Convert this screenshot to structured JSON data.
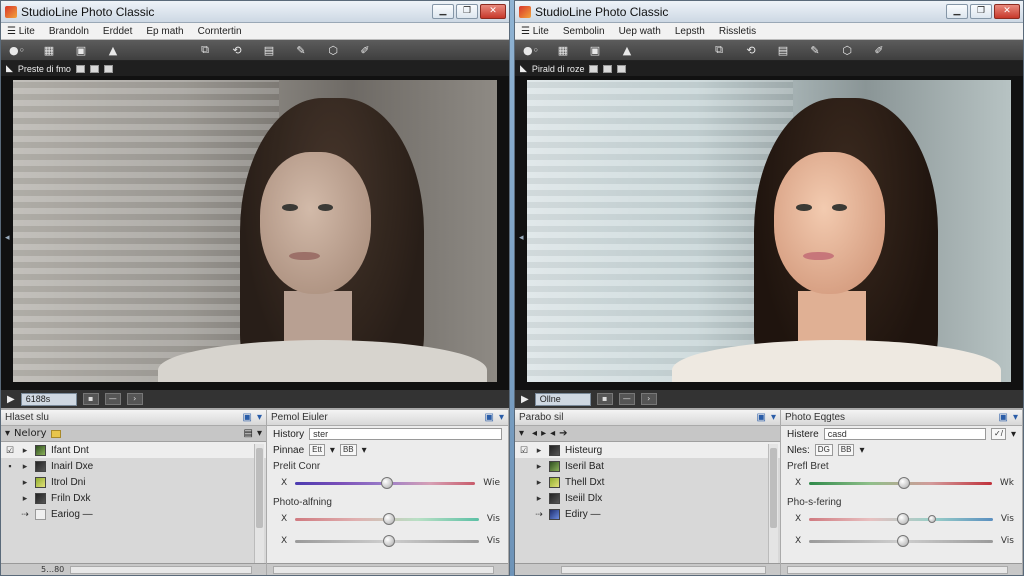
{
  "windows": [
    {
      "title": "StudioLine Photo Classic",
      "menu": [
        "☰ Lite",
        "Brandoln",
        "Erddet",
        "Ep math",
        "Corntertin"
      ],
      "strip_label": "Preste di fmo",
      "nav_field": "6188s",
      "tree": {
        "header": "Hlaset slu",
        "bar_label": "Nelory",
        "rows": [
          {
            "label": "Ifant Dnt",
            "thumb": "g",
            "selected": true,
            "arrow": "▸"
          },
          {
            "label": "Inairl Dxe",
            "thumb": "b",
            "selected": false,
            "arrow": "▸"
          },
          {
            "label": "Itrol Dni",
            "thumb": "y",
            "selected": false,
            "arrow": "▸"
          },
          {
            "label": "Friln Dxk",
            "thumb": "b",
            "selected": false,
            "arrow": "▸"
          },
          {
            "label": "Eariog —",
            "thumb": "w",
            "selected": false,
            "arrow": "⇢"
          }
        ],
        "status": "5…80"
      },
      "edit": {
        "header": "Pemol Eiuler",
        "history_label": "History",
        "history_value": "ster",
        "filter_label": "Pinnae",
        "filter_ctrl1": "Ett",
        "filter_ctrl2": "BB",
        "section1": "Prelit Conr",
        "sliders1": [
          {
            "left": "X",
            "right": "Wie",
            "value": 0.51,
            "gradient": "linear-gradient(90deg,#4b3bb0,#7a4fb8,#9a7dc8,#d6a0b5,#c85b6a)"
          }
        ],
        "section2": "Photo-alfning",
        "sliders2": [
          {
            "left": "X",
            "right": "Vis",
            "value": 0.51,
            "gradient": "linear-gradient(90deg,#d07a80,#e0b0b0,#b9e0c5,#5cc0a5)"
          },
          {
            "left": "X",
            "right": "Vis",
            "value": 0.51,
            "gradient": "linear-gradient(90deg,#9a9a9a,#cfcfcf,#9a9a9a)"
          }
        ]
      }
    },
    {
      "title": "StudioLine Photo Classic",
      "menu": [
        "☰ Lite",
        "Sembolin",
        "Uep wath",
        "Lepsth",
        "Rissletis"
      ],
      "strip_label": "Pirald di roze",
      "nav_field": "Ollne",
      "tree": {
        "header": "Parabo sil",
        "bar_label": "",
        "rows": [
          {
            "label": "Histeurg",
            "thumb": "b",
            "selected": true,
            "arrow": "▸"
          },
          {
            "label": "Iseril Bat",
            "thumb": "g",
            "selected": false,
            "arrow": "▸"
          },
          {
            "label": "Thell Dxt",
            "thumb": "y",
            "selected": false,
            "arrow": "▸"
          },
          {
            "label": "Iseiil Dlx",
            "thumb": "b",
            "selected": false,
            "arrow": "▸"
          },
          {
            "label": "Ediry —",
            "thumb": "pen",
            "selected": false,
            "arrow": "⇢"
          }
        ],
        "status": ""
      },
      "edit": {
        "header": "Photo Eqgtes",
        "history_label": "Histere",
        "history_value": "casd",
        "filter_label": "Nles:",
        "filter_ctrl1": "DG",
        "filter_ctrl2": "BB",
        "section1": "Prefl Bret",
        "sliders1": [
          {
            "left": "X",
            "right": "Wk",
            "value": 0.52,
            "gradient": "linear-gradient(90deg,#2f8a4a,#8fbf8a,#d29a9a,#c0303a)"
          }
        ],
        "section2": "Pho-s-fering",
        "sliders2": [
          {
            "left": "X",
            "right": "Vis",
            "value": 0.51,
            "gradient": "linear-gradient(90deg,#d07a80,#e8c0c0,#9ad0c8,#5a8fc0)",
            "second": 0.67
          },
          {
            "left": "X",
            "right": "Vis",
            "value": 0.51,
            "gradient": "linear-gradient(90deg,#9a9a9a,#cfcfcf,#9a9a9a)"
          }
        ]
      }
    }
  ]
}
